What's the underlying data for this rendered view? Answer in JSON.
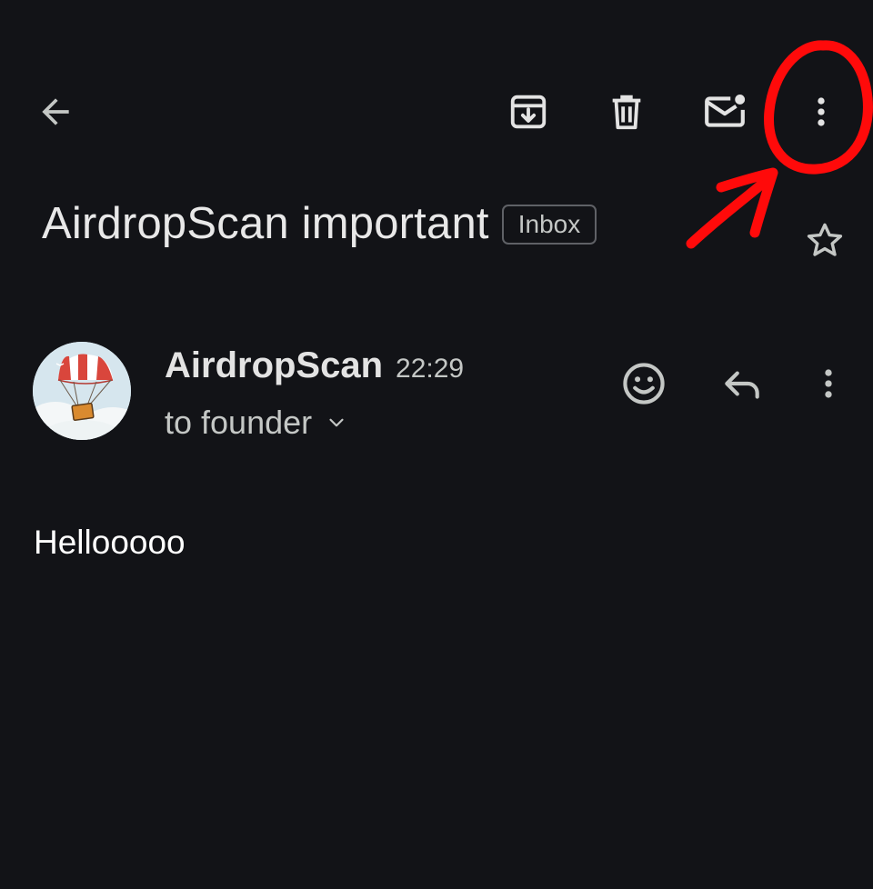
{
  "toolbar": {
    "back_icon": "arrow-back-icon",
    "archive_icon": "archive-icon",
    "delete_icon": "trash-icon",
    "mark_unread_icon": "mark-unread-icon",
    "more_icon": "more-vert-icon"
  },
  "email": {
    "subject": "AirdropScan important",
    "label": "Inbox",
    "star_icon": "star-outline-icon",
    "sender": {
      "name": "AirdropScan",
      "time": "22:29",
      "recipient": "to founder",
      "avatar": "parachute-avatar"
    },
    "actions": {
      "react_icon": "smiley-icon",
      "reply_icon": "reply-icon",
      "more_icon": "more-vert-icon"
    },
    "body": "Hellooooo"
  },
  "annotation": {
    "color": "#ff0000",
    "shapes": [
      "circle",
      "arrow"
    ]
  },
  "colors": {
    "background": "#121317",
    "text_primary": "#e3e3e3",
    "text_secondary": "#c4c7c5",
    "chip_border": "#5f6166"
  }
}
